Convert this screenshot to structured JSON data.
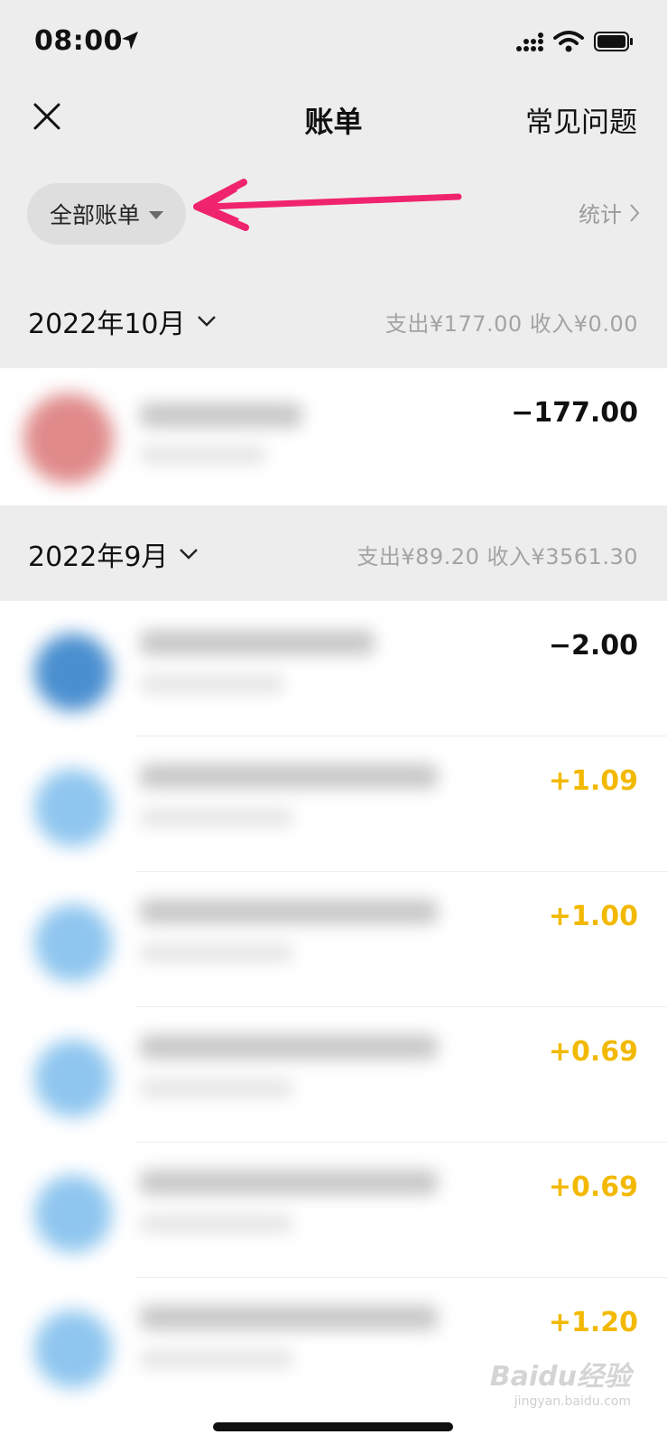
{
  "status_bar": {
    "time": "08:00"
  },
  "nav": {
    "title": "账单",
    "faq_label": "常见问题"
  },
  "filter": {
    "label": "全部账单",
    "stats_label": "统计"
  },
  "months": [
    {
      "title": "2022年10月",
      "summary": "支出¥177.00  收入¥0.00",
      "transactions": [
        {
          "amount": "−177.00",
          "type": "expense",
          "avatar_color": "#e08a8a"
        }
      ]
    },
    {
      "title": "2022年9月",
      "summary": "支出¥89.20  收入¥3561.30",
      "transactions": [
        {
          "amount": "−2.00",
          "type": "expense",
          "avatar_color": "#4a8fd0"
        },
        {
          "amount": "+1.09",
          "type": "income",
          "avatar_color": "#8fc6ef"
        },
        {
          "amount": "+1.00",
          "type": "income",
          "avatar_color": "#8fc6ef"
        },
        {
          "amount": "+0.69",
          "type": "income",
          "avatar_color": "#8fc6ef"
        },
        {
          "amount": "+0.69",
          "type": "income",
          "avatar_color": "#8fc6ef"
        },
        {
          "amount": "+1.20",
          "type": "income",
          "avatar_color": "#8fc6ef"
        }
      ]
    }
  ],
  "watermark": {
    "text": "Baidu经验",
    "sub": "jingyan.baidu.com"
  },
  "colors": {
    "income": "#f2b900",
    "annotation_arrow": "#f0246e",
    "header_bg": "#ededed"
  }
}
